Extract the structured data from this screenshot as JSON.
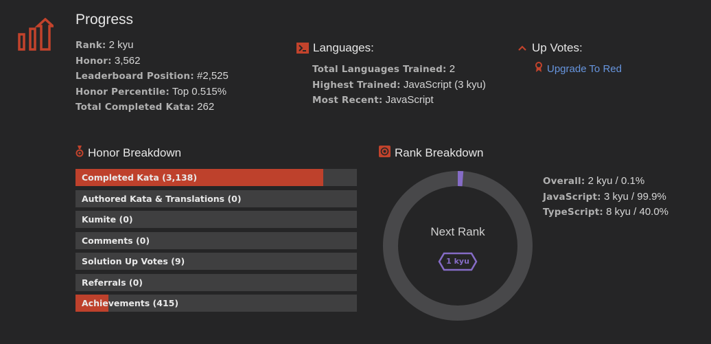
{
  "progress": {
    "title": "Progress",
    "stats": [
      {
        "label": "Rank:",
        "value": "2 kyu"
      },
      {
        "label": "Honor:",
        "value": "3,562"
      },
      {
        "label": "Leaderboard Position:",
        "value": "#2,525"
      },
      {
        "label": "Honor Percentile:",
        "value": "Top 0.515%"
      },
      {
        "label": "Total Completed Kata:",
        "value": "262"
      }
    ]
  },
  "languages": {
    "title": "Languages:",
    "stats": [
      {
        "label": "Total Languages Trained:",
        "value": "2"
      },
      {
        "label": "Highest Trained:",
        "value": "JavaScript (3 kyu)"
      },
      {
        "label": "Most Recent:",
        "value": "JavaScript"
      }
    ]
  },
  "up_votes": {
    "title": "Up Votes:",
    "upgrade_link": "Upgrade To Red"
  },
  "honor_breakdown": {
    "title": "Honor Breakdown",
    "bars": [
      {
        "label": "Completed Kata (3,138)",
        "fill": 0.881
      },
      {
        "label": "Authored Kata & Translations (0)",
        "fill": 0
      },
      {
        "label": "Kumite (0)",
        "fill": 0
      },
      {
        "label": "Comments (0)",
        "fill": 0
      },
      {
        "label": "Solution Up Votes (9)",
        "fill": 0
      },
      {
        "label": "Referrals (0)",
        "fill": 0
      },
      {
        "label": "Achievements (415)",
        "fill": 0.117
      }
    ]
  },
  "rank_breakdown": {
    "title": "Rank Breakdown",
    "next_rank_label": "Next Rank",
    "next_rank_badge": "1 kyu",
    "progress_fraction": 0.001,
    "ranks": [
      {
        "label": "Overall:",
        "value": "2 kyu / 0.1%"
      },
      {
        "label": "JavaScript:",
        "value": "3 kyu / 99.9%"
      },
      {
        "label": "TypeScript:",
        "value": "8 kyu / 40.0%"
      }
    ]
  },
  "colors": {
    "background": "#252526",
    "accent": "#be412c",
    "bar_track": "#3f3f40",
    "rank_purple": "#866cc7",
    "link": "#6795de"
  }
}
